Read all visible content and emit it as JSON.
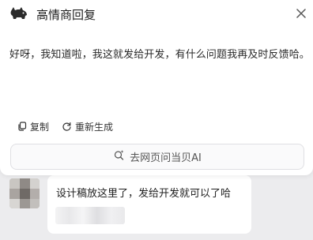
{
  "header": {
    "title": "高情商回复",
    "logo_icon": "pig-logo-icon",
    "close_icon": "close-icon"
  },
  "reply": {
    "text": "好呀，我知道啦，我这就发给开发，有什么问题我再及时反馈哈。"
  },
  "actions": {
    "copy_label": "复制",
    "regenerate_label": "重新生成"
  },
  "ask_button": {
    "label": "去网页问当贝AI",
    "icon": "sparkle-search-icon"
  },
  "chat": {
    "message_text": "设计稿放这里了，发给开发就可以了哈"
  },
  "colors": {
    "panel_bg": "#ffffff",
    "page_bg": "#ececee",
    "text": "#222222",
    "border": "#dfdfe3"
  }
}
